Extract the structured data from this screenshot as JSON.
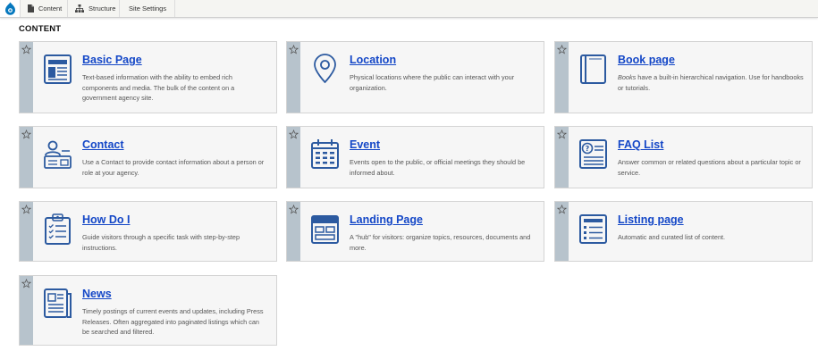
{
  "toolbar": {
    "items": [
      {
        "label": "Content",
        "icon": "file-icon"
      },
      {
        "label": "Structure",
        "icon": "sitemap-icon"
      },
      {
        "label": "Site Settings",
        "icon": ""
      }
    ]
  },
  "page_title": "CONTENT",
  "cards": [
    {
      "title": "Basic Page",
      "icon": "basic-page-icon",
      "desc_pre": "",
      "desc_em": "",
      "desc": "Text-based information with the ability to embed rich components and media. The bulk of the content on a government agency site."
    },
    {
      "title": "Location",
      "icon": "map-pin-icon",
      "desc_pre": "",
      "desc_em": "",
      "desc": "Physical locations where the public can interact with your organization."
    },
    {
      "title": "Book page",
      "icon": "book-icon",
      "desc_pre": "",
      "desc_em": "Books",
      "desc": " have a built-in hierarchical navigation. Use for handbooks or tutorials."
    },
    {
      "title": "Contact",
      "icon": "contact-icon",
      "desc_pre": "",
      "desc_em": "",
      "desc": "Use a Contact to provide contact information about a person or role at your agency."
    },
    {
      "title": "Event",
      "icon": "calendar-icon",
      "desc_pre": "",
      "desc_em": "",
      "desc": "Events open to the public, or official meetings they should be informed about."
    },
    {
      "title": "FAQ List",
      "icon": "faq-icon",
      "desc_pre": "",
      "desc_em": "",
      "desc": "Answer common or related questions about a particular topic or service."
    },
    {
      "title": "How Do I",
      "icon": "clipboard-icon",
      "desc_pre": "",
      "desc_em": "",
      "desc": "Guide visitors through a specific task with step-by-step instructions."
    },
    {
      "title": "Landing Page",
      "icon": "landing-page-icon",
      "desc_pre": "",
      "desc_em": "",
      "desc": "A \"hub\" for visitors: organize topics, resources, documents and more."
    },
    {
      "title": "Listing page",
      "icon": "listing-icon",
      "desc_pre": "",
      "desc_em": "",
      "desc": "Automatic and curated list of content."
    },
    {
      "title": "News",
      "icon": "newspaper-icon",
      "desc_pre": "",
      "desc_em": "",
      "desc": "Timely postings of current events and updates, including Press Releases. Often aggregated into paginated listings which can be searched and filtered."
    }
  ],
  "colors": {
    "accent": "#1447c7",
    "icon_blue": "#2c5aa0",
    "stripe": "#b7c3cc",
    "card_bg": "#f6f6f6"
  }
}
